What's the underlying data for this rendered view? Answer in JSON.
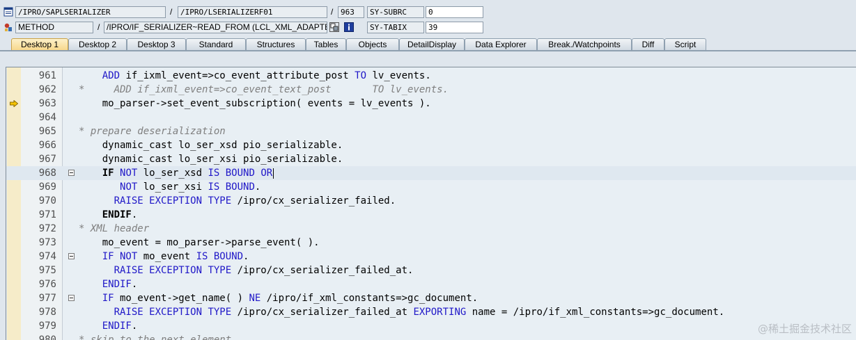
{
  "header": {
    "program": "/IPRO/SAPLSERIALIZER",
    "include": "/IPRO/LSERIALIZERF01",
    "line_no": "963",
    "sy_subrc_label": "SY-SUBRC",
    "sy_subrc_value": "0",
    "event_type": "METHOD",
    "event_name": "/IPRO/IF_SERIALIZER~READ_FROM (LCL_XML_ADAPTE...",
    "sy_tabix_label": "SY-TABIX",
    "sy_tabix_value": "39",
    "separator": "/"
  },
  "tabs": [
    {
      "label": "Desktop 1",
      "active": true
    },
    {
      "label": "Desktop 2"
    },
    {
      "label": "Desktop 3"
    },
    {
      "label": "Standard"
    },
    {
      "label": "Structures"
    },
    {
      "label": "Tables"
    },
    {
      "label": "Objects"
    },
    {
      "label": "DetailDisplay"
    },
    {
      "label": "Data Explorer"
    },
    {
      "label": "Break./Watchpoints"
    },
    {
      "label": "Diff"
    },
    {
      "label": "Script"
    }
  ],
  "code": [
    {
      "n": "961",
      "tokens": [
        [
          "",
          "    "
        ],
        [
          "kw",
          "ADD"
        ],
        [
          "",
          " if_ixml_event=>co_event_attribute_post "
        ],
        [
          "kw",
          "TO"
        ],
        [
          "",
          " lv_events."
        ]
      ]
    },
    {
      "n": "962",
      "tokens": [
        [
          "cm",
          "*     ADD if_ixml_event=>co_event_text_post       TO lv_events."
        ]
      ]
    },
    {
      "n": "963",
      "tokens": [
        [
          "",
          "    mo_parser->set_event_subscription( events = lv_events )."
        ]
      ]
    },
    {
      "n": "964",
      "tokens": []
    },
    {
      "n": "965",
      "tokens": [
        [
          "cm",
          "* prepare deserialization"
        ]
      ]
    },
    {
      "n": "966",
      "tokens": [
        [
          "",
          "    dynamic_cast lo_ser_xsd pio_serializable."
        ]
      ]
    },
    {
      "n": "967",
      "tokens": [
        [
          "",
          "    dynamic_cast lo_ser_xsi pio_serializable."
        ]
      ]
    },
    {
      "n": "968",
      "tokens": [
        [
          "",
          "    "
        ],
        [
          "bk",
          "IF"
        ],
        [
          "",
          " "
        ],
        [
          "kw",
          "NOT"
        ],
        [
          "",
          " lo_ser_xsd "
        ],
        [
          "kw",
          "IS BOUND OR"
        ]
      ]
    },
    {
      "n": "969",
      "tokens": [
        [
          "",
          "       "
        ],
        [
          "kw",
          "NOT"
        ],
        [
          "",
          " lo_ser_xsi "
        ],
        [
          "kw",
          "IS BOUND"
        ],
        [
          "",
          "."
        ]
      ]
    },
    {
      "n": "970",
      "tokens": [
        [
          "",
          "      "
        ],
        [
          "kw",
          "RAISE EXCEPTION TYPE"
        ],
        [
          "",
          " /ipro/cx_serializer_failed."
        ]
      ]
    },
    {
      "n": "971",
      "tokens": [
        [
          "",
          "    "
        ],
        [
          "bk",
          "ENDIF"
        ],
        [
          "",
          "."
        ]
      ]
    },
    {
      "n": "972",
      "tokens": [
        [
          "cm",
          "* XML header"
        ]
      ]
    },
    {
      "n": "973",
      "tokens": [
        [
          "",
          "    mo_event = mo_parser->parse_event( )."
        ]
      ]
    },
    {
      "n": "974",
      "tokens": [
        [
          "",
          "    "
        ],
        [
          "kw",
          "IF NOT"
        ],
        [
          "",
          " mo_event "
        ],
        [
          "kw",
          "IS BOUND"
        ],
        [
          "",
          "."
        ]
      ]
    },
    {
      "n": "975",
      "tokens": [
        [
          "",
          "      "
        ],
        [
          "kw",
          "RAISE EXCEPTION TYPE"
        ],
        [
          "",
          " /ipro/cx_serializer_failed_at."
        ]
      ]
    },
    {
      "n": "976",
      "tokens": [
        [
          "",
          "    "
        ],
        [
          "kw",
          "ENDIF"
        ],
        [
          "",
          "."
        ]
      ]
    },
    {
      "n": "977",
      "tokens": [
        [
          "",
          "    "
        ],
        [
          "kw",
          "IF"
        ],
        [
          "",
          " mo_event->get_name( ) "
        ],
        [
          "kw",
          "NE"
        ],
        [
          "",
          " /ipro/if_xml_constants=>gc_document."
        ]
      ]
    },
    {
      "n": "978",
      "tokens": [
        [
          "",
          "      "
        ],
        [
          "kw",
          "RAISE EXCEPTION TYPE"
        ],
        [
          "",
          " /ipro/cx_serializer_failed_at "
        ],
        [
          "kw",
          "EXPORTING"
        ],
        [
          "",
          " name = /ipro/if_xml_constants=>gc_document."
        ]
      ]
    },
    {
      "n": "979",
      "tokens": [
        [
          "",
          "    "
        ],
        [
          "kw",
          "ENDIF"
        ],
        [
          "",
          "."
        ]
      ]
    },
    {
      "n": "980",
      "tokens": [
        [
          "cm",
          "* skip to the next element"
        ]
      ]
    }
  ],
  "folds": [
    "968",
    "974",
    "977"
  ],
  "current_line": "963",
  "cursor_line": "968",
  "watermark": "@稀土掘金技术社区"
}
